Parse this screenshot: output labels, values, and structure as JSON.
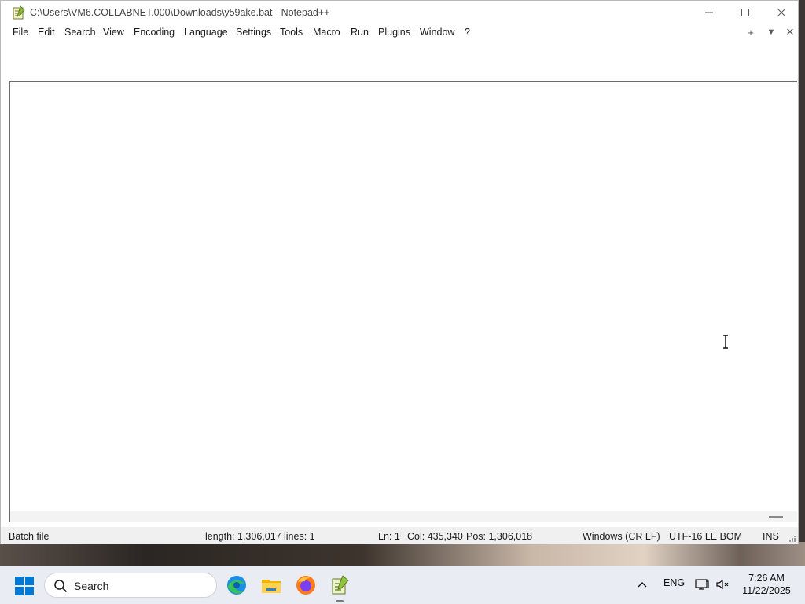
{
  "window": {
    "title": "C:\\Users\\VM6.COLLABNET.000\\Downloads\\y59ake.bat - Notepad++"
  },
  "menu": {
    "items": [
      "File",
      "Edit",
      "Search",
      "View",
      "Encoding",
      "Language",
      "Settings",
      "Tools",
      "Macro",
      "Run",
      "Plugins",
      "Window",
      "?"
    ],
    "right_buttons": [
      "+",
      "▼",
      "✕"
    ]
  },
  "status": {
    "file_type": "Batch file",
    "length": "length: 1,306,017",
    "lines": "lines: 1",
    "ln": "Ln: 1",
    "col": "Col: 435,340",
    "pos": "Pos: 1,306,018",
    "eol": "Windows (CR LF)",
    "encoding": "UTF-16 LE BOM",
    "mode": "INS"
  },
  "taskbar": {
    "search_label": "Search",
    "apps": [
      "edge-icon",
      "file-explorer-icon",
      "firefox-icon",
      "notepad-plus-plus-icon"
    ],
    "tray": {
      "language": "ENG",
      "time": "7:26 AM",
      "date": "11/22/2025"
    }
  },
  "colors": {
    "taskbar_bg": "#e9edf3",
    "window_bg": "#ffffff",
    "statusbar_bg": "#f0f0f0",
    "windows_blue": "#0078d4"
  }
}
